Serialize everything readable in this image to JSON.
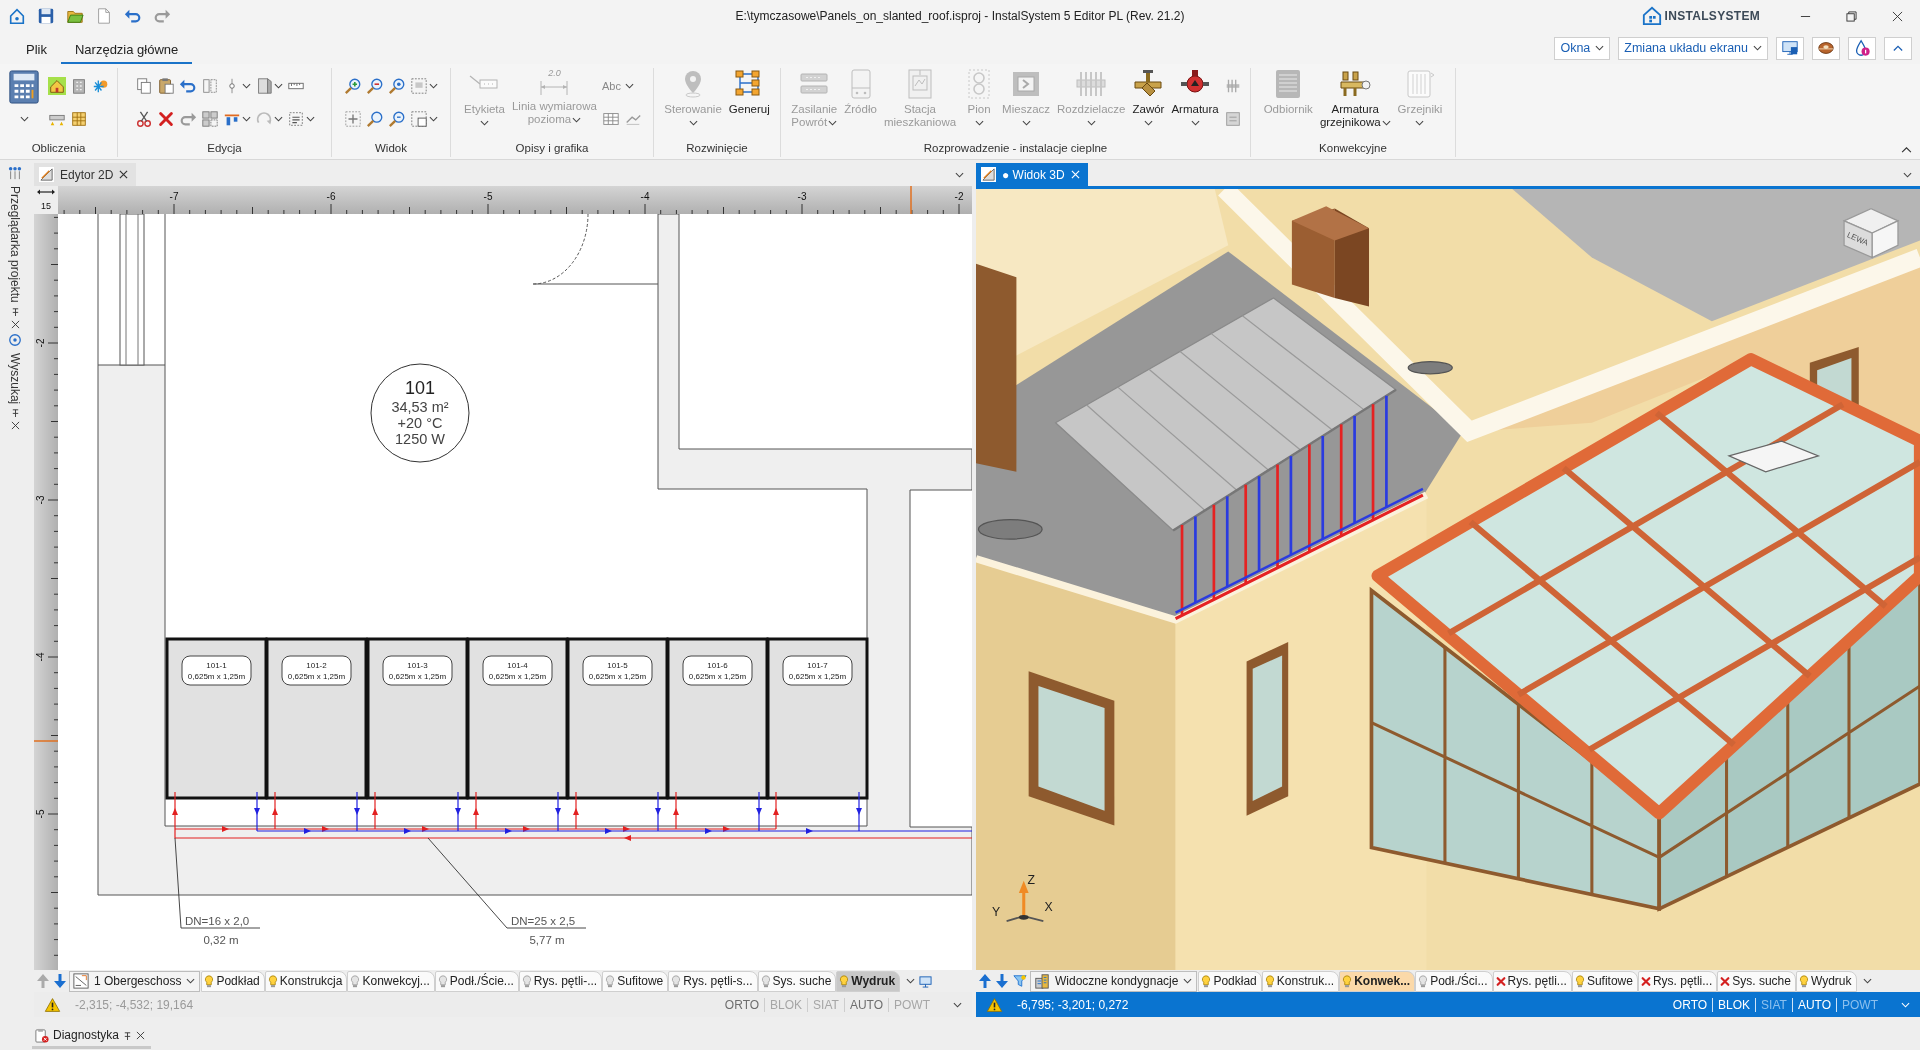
{
  "window": {
    "title": "E:\\tymczasowe\\Panels_on_slanted_roof.isproj - InstalSystem 5 Editor PL (Rev. 21.2)",
    "brand": "INSTALSYSTEM"
  },
  "menu": {
    "tabs": [
      {
        "label": "Plik",
        "selected": false
      },
      {
        "label": "Narzędzia główne",
        "selected": true
      }
    ],
    "dropdowns": [
      "Okna",
      "Zmiana układu ekranu"
    ]
  },
  "ribbon": {
    "groups": [
      {
        "label": "Obliczenia"
      },
      {
        "label": "Edycja"
      },
      {
        "label": "Widok"
      },
      {
        "label": "Opisy i grafika",
        "tools": [
          {
            "lines": [
              "Etykieta"
            ],
            "disabled": true,
            "dropdown": true
          },
          {
            "lines": [
              "Linia wymiarowa",
              "pozioma"
            ],
            "disabled": true,
            "dropdown": true,
            "icon_text": "2.0"
          }
        ],
        "style_button": "Abc"
      },
      {
        "label": "Rozwinięcie",
        "tools": [
          {
            "lines": [
              "Sterowanie"
            ],
            "disabled": true,
            "dropdown": true
          },
          {
            "lines": [
              "Generuj"
            ],
            "disabled": false,
            "dropdown": false
          }
        ]
      },
      {
        "label": "Rozprowadzenie - instalacje cieplne",
        "tools": [
          {
            "lines": [
              "Zasilanie",
              "Powrót"
            ],
            "disabled": true,
            "dropdown": true
          },
          {
            "lines": [
              "Źródło"
            ],
            "disabled": true,
            "dropdown": false
          },
          {
            "lines": [
              "Stacja",
              "mieszkaniowa"
            ],
            "disabled": true,
            "dropdown": false
          },
          {
            "lines": [
              "Pion"
            ],
            "disabled": true,
            "dropdown": true
          },
          {
            "lines": [
              "Mieszacz"
            ],
            "disabled": true,
            "dropdown": true
          },
          {
            "lines": [
              "Rozdzielacze"
            ],
            "disabled": true,
            "dropdown": true
          },
          {
            "lines": [
              "Zawór"
            ],
            "disabled": false,
            "dropdown": true
          },
          {
            "lines": [
              "Armatura"
            ],
            "disabled": false,
            "dropdown": true
          }
        ]
      },
      {
        "label": "Konwekcyjne",
        "tools": [
          {
            "lines": [
              "Odbiornik"
            ],
            "disabled": true,
            "dropdown": false
          },
          {
            "lines": [
              "Armatura",
              "grzejnikowa"
            ],
            "disabled": false,
            "dropdown": true
          },
          {
            "lines": [
              "Grzejniki"
            ],
            "disabled": true,
            "dropdown": true
          }
        ]
      }
    ]
  },
  "sidebar": {
    "tabs": [
      "Przeglądarka projektu",
      "Wyszukaj"
    ]
  },
  "editor_2d": {
    "tab": {
      "label": "Edytor 2D",
      "selected": false
    },
    "ruler": {
      "scale": "15",
      "x_labels": [
        "-7",
        "-6",
        "-5",
        "-4",
        "-3",
        "-2"
      ],
      "y_labels": [
        "-2",
        "-3",
        "-4",
        "-5"
      ]
    },
    "room": {
      "number": "101",
      "area": "34,53 m²",
      "temperature": "+20 °C",
      "load": "1250 W"
    },
    "panels": [
      {
        "name": "101-1",
        "size": "0,625m x 1,25m"
      },
      {
        "name": "101-2",
        "size": "0,625m x 1,25m"
      },
      {
        "name": "101-3",
        "size": "0,625m x 1,25m"
      },
      {
        "name": "101-4",
        "size": "0,625m x 1,25m"
      },
      {
        "name": "101-5",
        "size": "0,625m x 1,25m"
      },
      {
        "name": "101-6",
        "size": "0,625m x 1,25m"
      },
      {
        "name": "101-7",
        "size": "0,625m x 1,25m"
      }
    ],
    "pipe_labels": [
      {
        "dimension": "DN=16 x 2,0",
        "length": "0,32 m"
      },
      {
        "dimension": "DN=25 x 2,5",
        "length": "5,77 m"
      }
    ],
    "layer_bar": {
      "storey": "1 Obergeschoss",
      "layers": [
        {
          "label": "Podkład",
          "kind": "lit",
          "selected": false
        },
        {
          "label": "Konstrukcja",
          "kind": "lit",
          "selected": false
        },
        {
          "label": "Konwekcyj...",
          "kind": "unlit",
          "selected": false
        },
        {
          "label": "Podł./Ście...",
          "kind": "unlit",
          "selected": false
        },
        {
          "label": "Rys. pętli-...",
          "kind": "unlit",
          "selected": false
        },
        {
          "label": "Sufitowe",
          "kind": "unlit",
          "selected": false
        },
        {
          "label": "Rys. pętli-s...",
          "kind": "unlit",
          "selected": false
        },
        {
          "label": "Sys. suche",
          "kind": "unlit",
          "selected": false
        },
        {
          "label": "Wydruk",
          "kind": "lit",
          "selected": true
        }
      ]
    },
    "status": {
      "coordinates": "-2,315; -4,532; 19,164",
      "modes": [
        {
          "label": "ORTO",
          "on": true
        },
        {
          "label": "BLOK",
          "on": false
        },
        {
          "label": "SIAT",
          "on": false
        },
        {
          "label": "AUTO",
          "on": true
        },
        {
          "label": "POWT",
          "on": false
        }
      ]
    }
  },
  "view_3d": {
    "tab": {
      "label": "● Widok 3D",
      "selected": true
    },
    "view_cube": "LEWA",
    "axes": {
      "z": "Z",
      "x": "X",
      "y": "Y"
    },
    "layer_bar": {
      "storey": "Widoczne kondygnacje",
      "layers": [
        {
          "label": "Podkład",
          "kind": "lit",
          "selected": false
        },
        {
          "label": "Konstruk...",
          "kind": "lit",
          "selected": false
        },
        {
          "label": "Konwek...",
          "kind": "lit",
          "selected": true
        },
        {
          "label": "Podł./Ści...",
          "kind": "unlit",
          "selected": false
        },
        {
          "label": "Rys. pętli...",
          "kind": "excluded",
          "selected": false
        },
        {
          "label": "Sufitowe",
          "kind": "lit",
          "selected": false
        },
        {
          "label": "Rys. pętli...",
          "kind": "excluded",
          "selected": false
        },
        {
          "label": "Sys. suche",
          "kind": "excluded",
          "selected": false
        },
        {
          "label": "Wydruk",
          "kind": "lit",
          "selected": false
        }
      ]
    },
    "status": {
      "coordinates": "-6,795; -3,201; 0,272",
      "modes": [
        {
          "label": "ORTO",
          "on": true
        },
        {
          "label": "BLOK",
          "on": true
        },
        {
          "label": "SIAT",
          "on": false
        },
        {
          "label": "AUTO",
          "on": true
        },
        {
          "label": "POWT",
          "on": false
        }
      ]
    }
  },
  "bottom_panel": {
    "label": "Diagnostyka"
  }
}
